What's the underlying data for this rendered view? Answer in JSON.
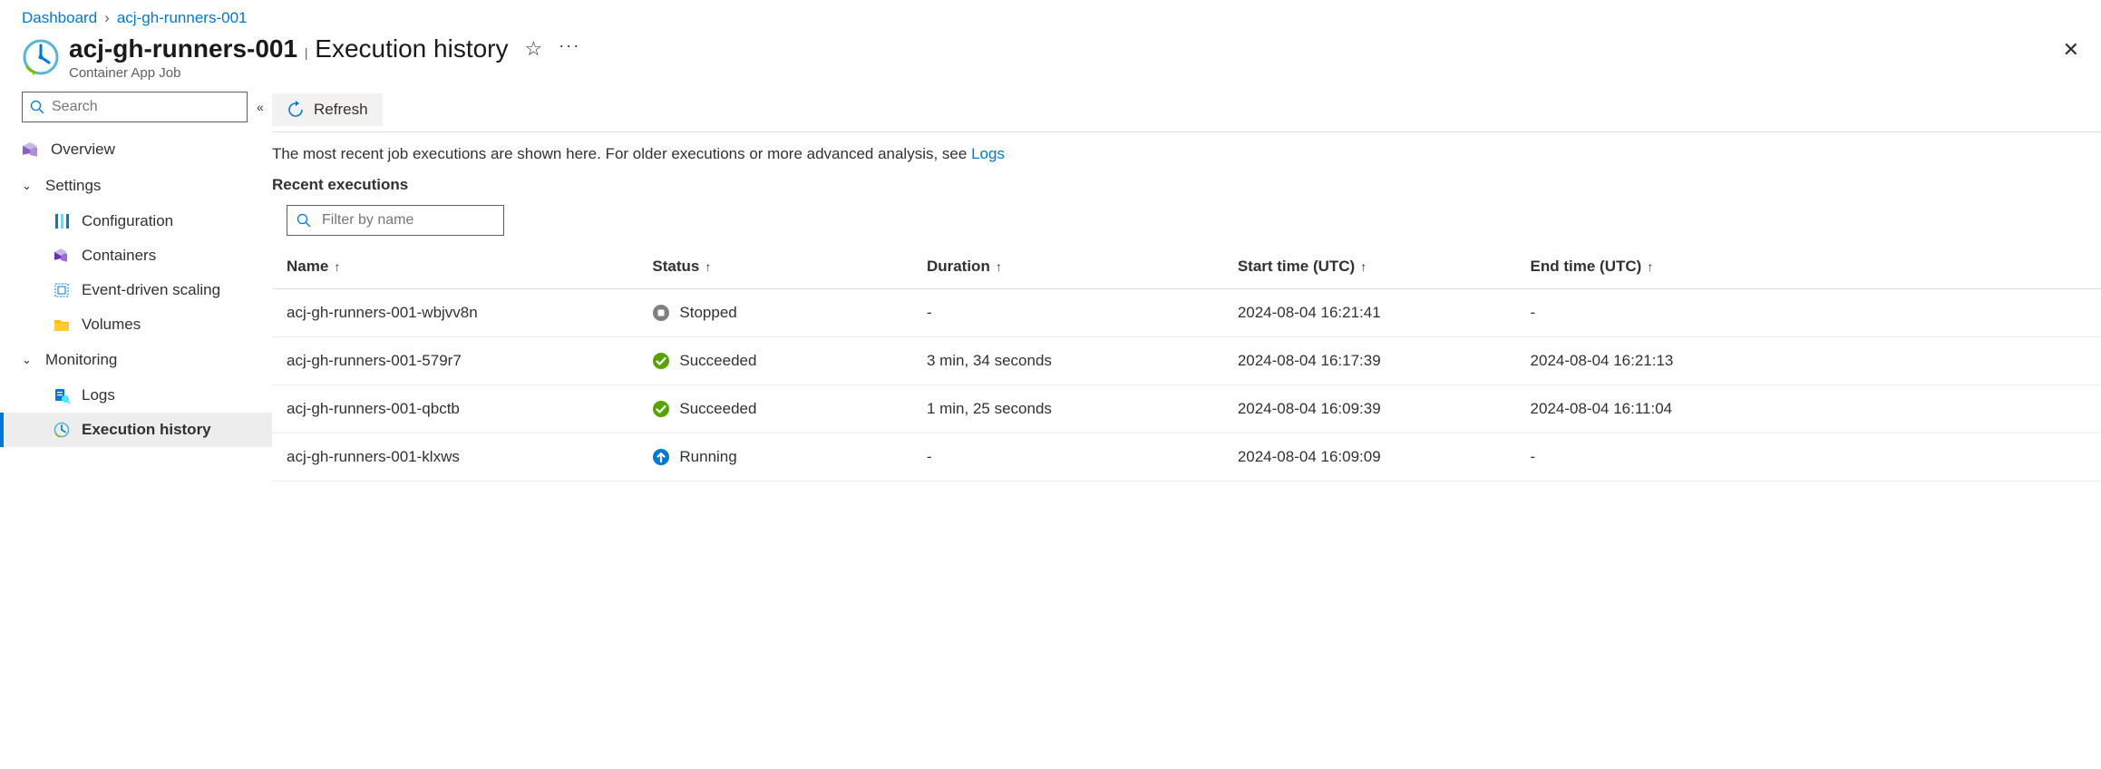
{
  "breadcrumb": {
    "root": "Dashboard",
    "current": "acj-gh-runners-001"
  },
  "header": {
    "resource_name": "acj-gh-runners-001",
    "page_title": "Execution history",
    "resource_type": "Container App Job"
  },
  "sidebar": {
    "search_placeholder": "Search",
    "overview": "Overview",
    "settings_group": "Settings",
    "configuration": "Configuration",
    "containers": "Containers",
    "event_driven_scaling": "Event-driven scaling",
    "volumes": "Volumes",
    "monitoring_group": "Monitoring",
    "logs": "Logs",
    "execution_history": "Execution history"
  },
  "toolbar": {
    "refresh_label": "Refresh"
  },
  "hint": {
    "text": "The most recent job executions are shown here. For older executions or more advanced analysis, see ",
    "link_label": "Logs"
  },
  "section": {
    "title": "Recent executions",
    "filter_placeholder": "Filter by name"
  },
  "columns": {
    "name": "Name",
    "status": "Status",
    "duration": "Duration",
    "start": "Start time (UTC)",
    "end": "End time (UTC)"
  },
  "rows": [
    {
      "name": "acj-gh-runners-001-wbjvv8n",
      "status": "Stopped",
      "status_kind": "stopped",
      "duration": "-",
      "start": "2024-08-04 16:21:41",
      "end": "-"
    },
    {
      "name": "acj-gh-runners-001-579r7",
      "status": "Succeeded",
      "status_kind": "succeeded",
      "duration": "3 min, 34 seconds",
      "start": "2024-08-04 16:17:39",
      "end": "2024-08-04 16:21:13"
    },
    {
      "name": "acj-gh-runners-001-qbctb",
      "status": "Succeeded",
      "status_kind": "succeeded",
      "duration": "1 min, 25 seconds",
      "start": "2024-08-04 16:09:39",
      "end": "2024-08-04 16:11:04"
    },
    {
      "name": "acj-gh-runners-001-klxws",
      "status": "Running",
      "status_kind": "running",
      "duration": "-",
      "start": "2024-08-04 16:09:09",
      "end": "-"
    }
  ]
}
